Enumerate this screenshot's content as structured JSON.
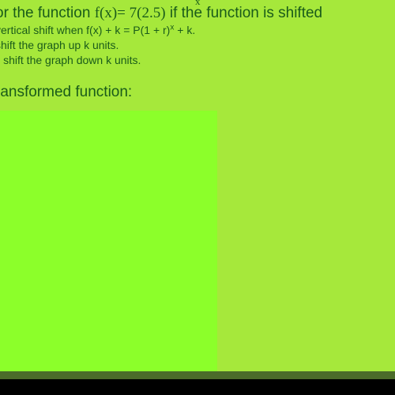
{
  "slide": {
    "line1_a": "or the function ",
    "line1_b": "f(x)= 7(2.5)",
    "line1_sup": "x",
    "line1_c": " if the function is shifted",
    "line2": " vertical shift when f(x) + k = P(1 + r)",
    "line2_sup": "x",
    "line2_b": " + k.",
    "line3": " shift the graph up k units.",
    "line4": "ll shift the graph down k units.",
    "heading": "ransformed function:"
  },
  "chart_data": {
    "type": "area",
    "title": "",
    "series": [],
    "notes": "Bright green rectangular region shown without plotted data"
  }
}
